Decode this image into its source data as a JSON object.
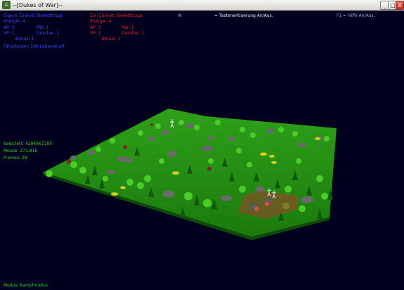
{
  "window": {
    "title": "--[Dukes of War]--",
    "buttons": {
      "minimize": "_",
      "maximize": "□",
      "close": "X"
    }
  },
  "own_unit": {
    "label": "Eigene Einheit: Skeletttrupp",
    "energy": "Energie: 4",
    "ap": "AP: 3",
    "rw": "RW: 1",
    "vp": "VP: 1",
    "speed": "Geschw.: 1",
    "bonus": "Bonus: 1",
    "ability": "Fähigkeiten: 100 Lebenskraft"
  },
  "target_unit": {
    "label": "Ziel Einheit: Skeletttrupp",
    "energy": "Energie: 4",
    "ap": "AP: 3",
    "rw": "RW: 1",
    "vp": "VP: 1",
    "speed": "Geschw.: 1",
    "bonus": "Bonus: 1"
  },
  "hotkeys": {
    "h_key": "H",
    "h_desc": "= Tastenerklaerung An/Aus.",
    "f1_desc": "F1 = Hilfe An/Aus."
  },
  "debug": {
    "select_hit": "SelectHit: 4294967295",
    "mouse": "Mouse: 271,816",
    "frames": "Frames: 28"
  },
  "status": {
    "mode": "Modus: Kampfmodus"
  },
  "colors": {
    "terrain": "#1f8a10",
    "sky": "#00001e",
    "selection": "#e03030",
    "own_text": "#3a4cf0",
    "target_text": "#e02828",
    "debug_text": "#30d030"
  }
}
